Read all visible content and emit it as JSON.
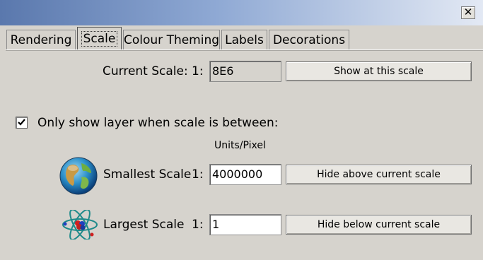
{
  "window": {
    "close_glyph": "✕"
  },
  "tabs": [
    {
      "label": "Rendering",
      "active": false
    },
    {
      "label": "Scale",
      "active": true
    },
    {
      "label": "Colour Theming",
      "active": false
    },
    {
      "label": "Labels",
      "active": false
    },
    {
      "label": "Decorations",
      "active": false
    }
  ],
  "current_scale": {
    "label": "Current Scale:",
    "prefix": "1:",
    "value": "8E6",
    "button": "Show at this scale"
  },
  "only_show": {
    "checked": true,
    "label": "Only show layer when scale is between:"
  },
  "units_label": "Units/Pixel",
  "smallest": {
    "icon": "globe-icon",
    "label": "Smallest Scale",
    "prefix": "1:",
    "value": "4000000",
    "button": "Hide above current scale"
  },
  "largest": {
    "icon": "atom-icon",
    "label": "Largest Scale",
    "prefix": "1:",
    "value": "1",
    "button": "Hide below current scale"
  }
}
